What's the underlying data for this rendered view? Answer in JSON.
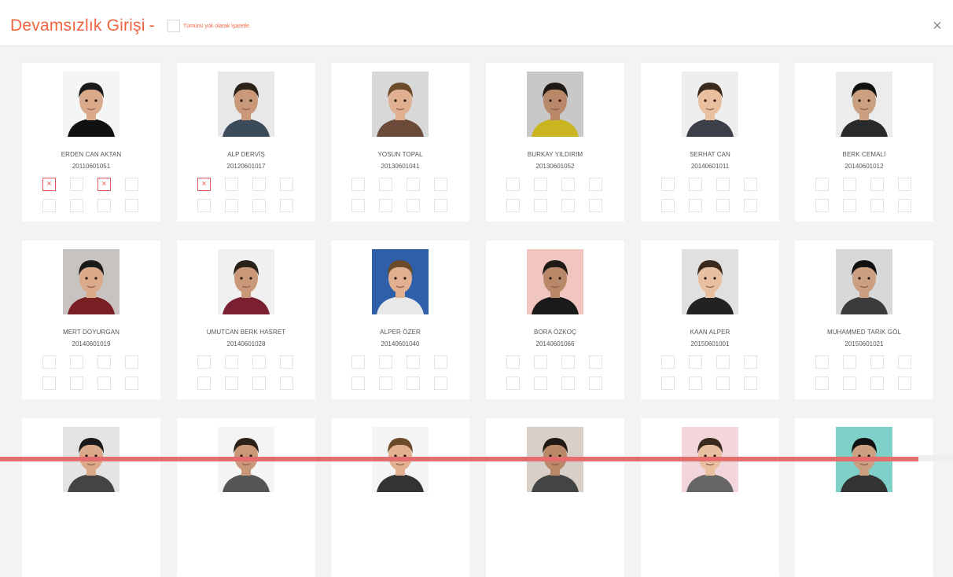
{
  "header": {
    "title": "Devamsızlık Girişi",
    "title_dash": "-",
    "mark_all_label": "Tümünü yok olarak işaretle.",
    "close_symbol": "×"
  },
  "colors": {
    "accent": "#f26440",
    "absent_mark": "#e25a5a",
    "bottom_bar": "#e46d6d"
  },
  "students": [
    {
      "name": "ERDEN CAN AKTAN",
      "number": "20110601051",
      "marks": [
        "x",
        "",
        "x",
        "",
        "",
        "",
        "",
        ""
      ]
    },
    {
      "name": "ALP DERVİŞ",
      "number": "20120601017",
      "marks": [
        "x",
        "",
        "",
        "",
        "",
        "",
        "",
        ""
      ]
    },
    {
      "name": "YOSUN TOPAL",
      "number": "20130601041",
      "marks": [
        "",
        "",
        "",
        "",
        "",
        "",
        "",
        ""
      ]
    },
    {
      "name": "BURKAY YILDIRIM",
      "number": "20130601052",
      "marks": [
        "",
        "",
        "",
        "",
        "",
        "",
        "",
        ""
      ]
    },
    {
      "name": "SERHAT CAN",
      "number": "20140601011",
      "marks": [
        "",
        "",
        "",
        "",
        "",
        "",
        "",
        ""
      ]
    },
    {
      "name": "BERK CEMALİ",
      "number": "20140601012",
      "marks": [
        "",
        "",
        "",
        "",
        "",
        "",
        "",
        ""
      ]
    },
    {
      "name": "MERT DOYURGAN",
      "number": "20140601019",
      "marks": [
        "",
        "",
        "",
        "",
        "",
        "",
        "",
        ""
      ]
    },
    {
      "name": "UMUTCAN BERK HASRET",
      "number": "20140601028",
      "marks": [
        "",
        "",
        "",
        "",
        "",
        "",
        "",
        ""
      ]
    },
    {
      "name": "ALPER ÖZER",
      "number": "20140601040",
      "marks": [
        "",
        "",
        "",
        "",
        "",
        "",
        "",
        ""
      ]
    },
    {
      "name": "BORA ÖZKOÇ",
      "number": "20140601066",
      "marks": [
        "",
        "",
        "",
        "",
        "",
        "",
        "",
        ""
      ]
    },
    {
      "name": "KAAN ALPER",
      "number": "20150601001",
      "marks": [
        "",
        "",
        "",
        "",
        "",
        "",
        "",
        ""
      ]
    },
    {
      "name": "MUHAMMED TARIK GÖL",
      "number": "20150601021",
      "marks": [
        "",
        "",
        "",
        "",
        "",
        "",
        "",
        ""
      ]
    },
    {
      "name": "",
      "number": "",
      "marks": []
    },
    {
      "name": "",
      "number": "",
      "marks": []
    },
    {
      "name": "",
      "number": "",
      "marks": []
    },
    {
      "name": "",
      "number": "",
      "marks": []
    },
    {
      "name": "",
      "number": "",
      "marks": []
    },
    {
      "name": "",
      "number": "",
      "marks": []
    }
  ]
}
